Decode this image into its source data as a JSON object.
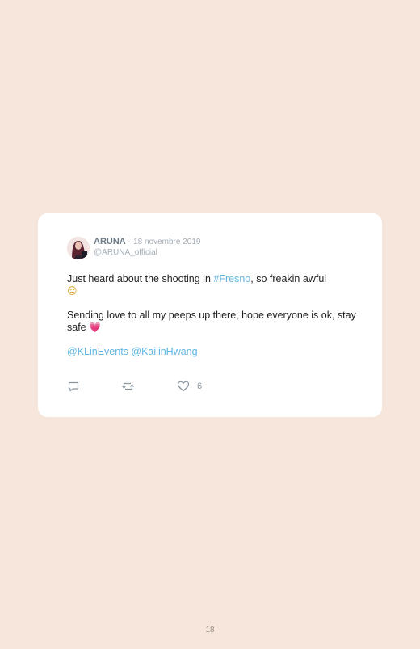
{
  "tweet": {
    "author": "ARUNA",
    "separator": "·",
    "date": "18 novembre 2019",
    "handle": "@ARUNA_official",
    "line1_before": "Just heard about the shooting in ",
    "hashtag": "#Fresno",
    "line1_after": ", so freakin awful",
    "emoji_sad": "😔",
    "line2": "Sending love to all my peeps up there, hope everyone is ok, stay safe",
    "emoji_heart": "💗",
    "mention1": "@KLinEvents",
    "mention2": "@KailinHwang",
    "like_count": "6"
  },
  "icons": {
    "reply": "reply-icon",
    "retweet": "retweet-icon",
    "like": "heart-icon"
  },
  "colors": {
    "background": "#f7e6dc",
    "link": "#5fb6e2",
    "muted": "#a3adb6"
  },
  "page": {
    "number": "18"
  }
}
